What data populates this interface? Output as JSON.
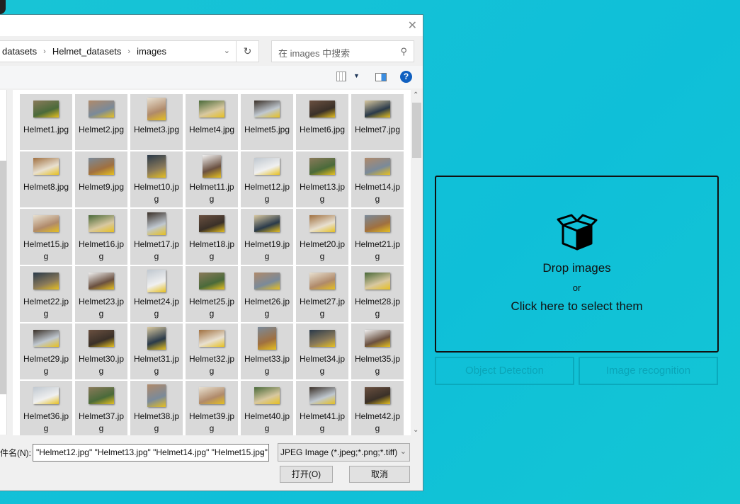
{
  "dialog": {
    "breadcrumb": [
      "datasets",
      "Helmet_datasets",
      "images"
    ],
    "search_placeholder": "在 images 中搜索",
    "files": [
      "Helmet1.jpg",
      "Helmet2.jpg",
      "Helmet3.jpg",
      "Helmet4.jpg",
      "Helmet5.jpg",
      "Helmet6.jpg",
      "Helmet7.jpg",
      "Helmet8.jpg",
      "Helmet9.jpg",
      "Helmet10.jpg",
      "Helmet11.jpg",
      "Helmet12.jpg",
      "Helmet13.jpg",
      "Helmet14.jpg",
      "Helmet15.jpg",
      "Helmet16.jpg",
      "Helmet17.jpg",
      "Helmet18.jpg",
      "Helmet19.jpg",
      "Helmet20.jpg",
      "Helmet21.jpg",
      "Helmet22.jpg",
      "Helmet23.jpg",
      "Helmet24.jpg",
      "Helmet25.jpg",
      "Helmet26.jpg",
      "Helmet27.jpg",
      "Helmet28.jpg",
      "Helmet29.jpg",
      "Helmet30.jpg",
      "Helmet31.jpg",
      "Helmet32.jpg",
      "Helmet33.jpg",
      "Helmet34.jpg",
      "Helmet35.jpg",
      "Helmet36.jpg",
      "Helmet37.jpg",
      "Helmet38.jpg",
      "Helmet39.jpg",
      "Helmet40.jpg",
      "Helmet41.jpg",
      "Helmet42.jpg"
    ],
    "filename_label": "件名(N):",
    "filename_value": "\"Helmet12.jpg\" \"Helmet13.jpg\" \"Helmet14.jpg\" \"Helmet15.jpg\"",
    "filetype": "JPEG Image (*.jpeg;*.png;*.tiff)",
    "open_label": "打开(O)",
    "cancel_label": "取消"
  },
  "app": {
    "drop_title": "Drop images",
    "drop_or": "or",
    "drop_click": "Click here to select them",
    "object_detection": "Object Detection",
    "image_recognition": "Image recognition",
    "accent": "#12c3d6"
  }
}
